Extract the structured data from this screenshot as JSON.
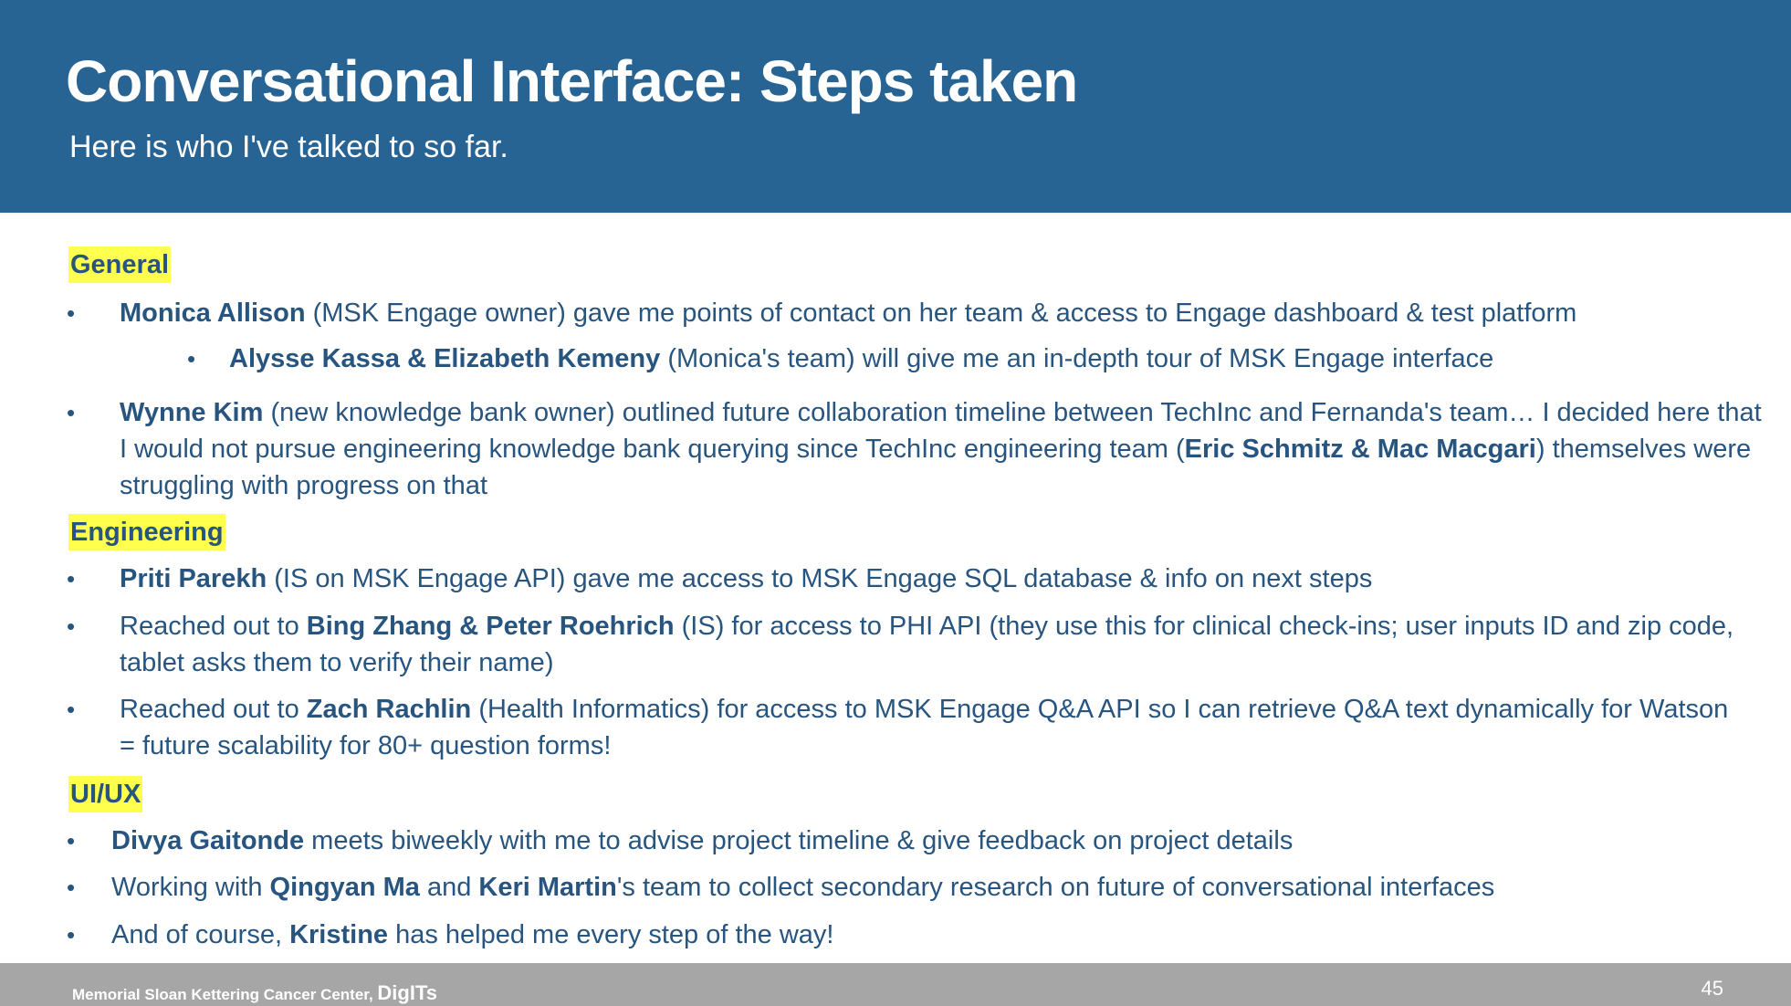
{
  "header": {
    "title": "Conversational Interface: Steps taken",
    "subtitle": "Here is who I've talked to so far."
  },
  "sections": {
    "general": {
      "label": "General",
      "items": [
        {
          "name": "Monica Allison",
          "text": " (MSK Engage owner) gave me points of contact on her team & access to Engage dashboard & test platform"
        },
        {
          "name": "Alysse Kassa & Elizabeth Kemeny",
          "text": " (Monica's team) will give me an in-depth tour of MSK Engage interface"
        },
        {
          "name": "Wynne Kim",
          "text": " (new knowledge bank owner) outlined future collaboration timeline between TechInc and Fernanda's team… I decided here that I would not pursue engineering knowledge bank querying since TechInc engineering team (",
          "name2": "Eric Schmitz & Mac Macgari",
          "text2": ") themselves were struggling with progress on that"
        }
      ]
    },
    "engineering": {
      "label": "Engineering",
      "items": [
        {
          "name": "Priti Parekh",
          "text": " (IS on MSK Engage API) gave me access to MSK Engage SQL database & info on next steps"
        },
        {
          "prefix": "Reached out to ",
          "name": "Bing Zhang & Peter Roehrich",
          "text": " (IS) for access to PHI API (they use this for clinical check-ins; user inputs ID and zip code, tablet asks them to verify their name)"
        },
        {
          "prefix": "Reached out to ",
          "name": "Zach Rachlin",
          "text": " (Health Informatics) for access to MSK Engage Q&A API so I can retrieve Q&A text dynamically for Watson = future scalability for 80+ question forms!"
        }
      ]
    },
    "uiux": {
      "label": "UI/UX",
      "items": [
        {
          "name": "Divya Gaitonde",
          "text": " meets biweekly with me to advise project timeline & give feedback on project details"
        },
        {
          "prefix": "Working with ",
          "name": "Qingyan Ma",
          "mid": " and ",
          "name2": "Keri Martin",
          "text": "'s team to collect secondary research on future of conversational interfaces"
        },
        {
          "prefix": "And of course, ",
          "name": "Kristine",
          "text": " has helped me every step of the way!"
        }
      ]
    }
  },
  "bullet": "•",
  "footer": {
    "org": "Memorial Sloan Kettering Cancer Center, ",
    "org_strong": "DigITs",
    "page": "45"
  }
}
